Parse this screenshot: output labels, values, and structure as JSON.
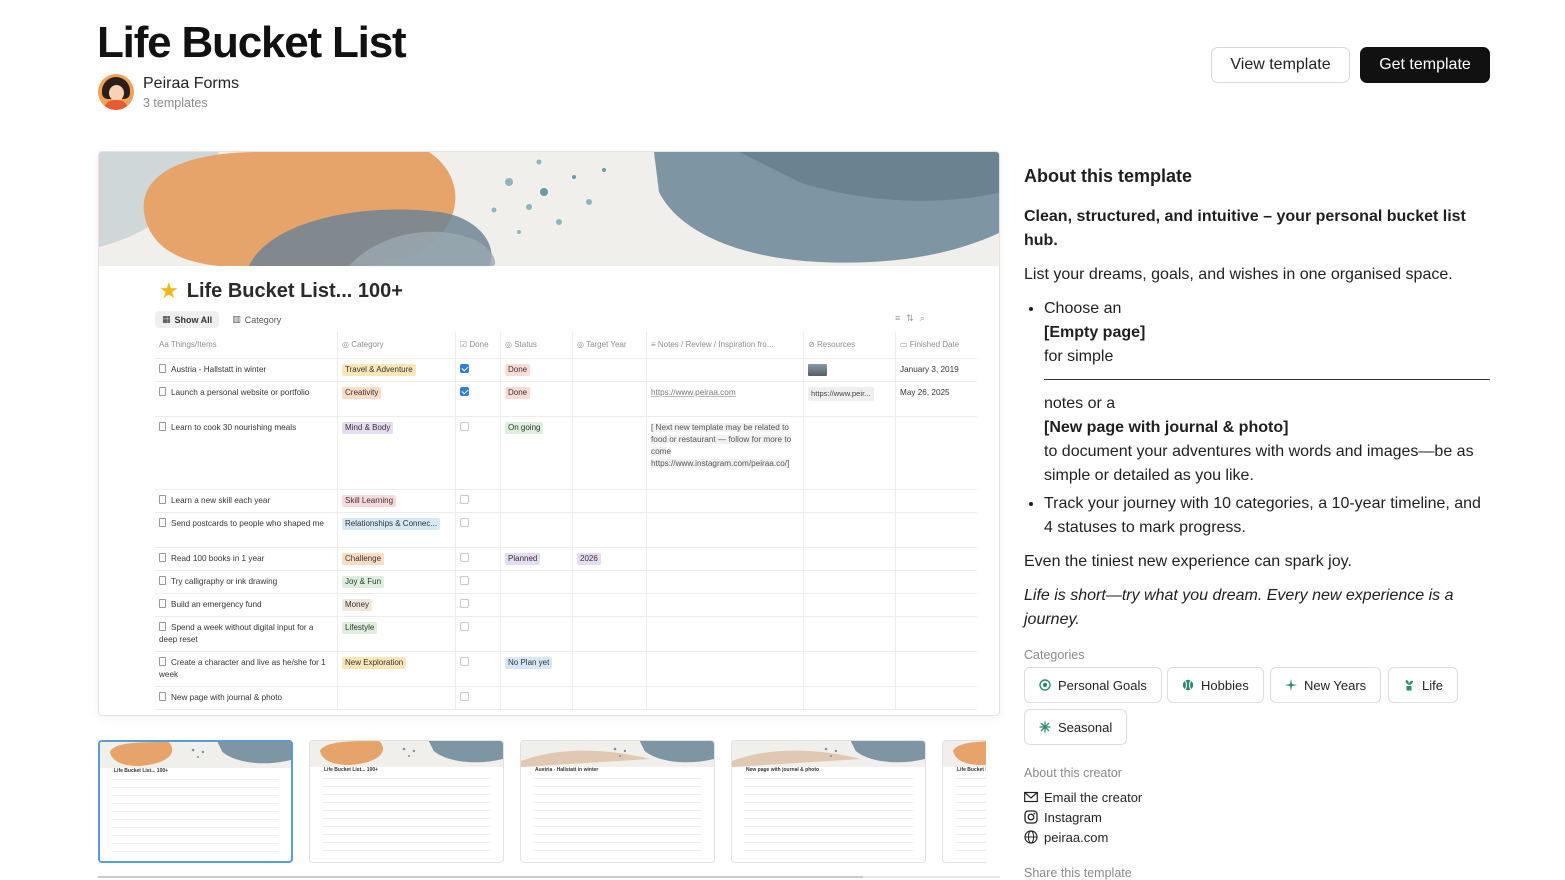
{
  "header": {
    "title": "Life Bucket List",
    "creator_name": "Peiraa Forms",
    "creator_sub": "3 templates",
    "view_label": "View template",
    "get_label": "Get template"
  },
  "preview": {
    "title": "Life Bucket List... 100+",
    "tabs": [
      "Show All",
      "Category"
    ],
    "columns": [
      "Things/Items",
      "Category",
      "Done",
      "Status",
      "Target Year",
      "Notes / Review / Inspiration fro...",
      "Resources",
      "Finished Date"
    ],
    "rows": [
      {
        "item": "Austria - Hallstatt in winter",
        "category": "Travel & Adventure",
        "done": true,
        "status": "Done",
        "year": "",
        "notes": "",
        "resources": "img",
        "finished": "January 3, 2019"
      },
      {
        "item": "Launch a personal website or portfolio",
        "category": "Creativity",
        "done": true,
        "status": "Done",
        "year": "",
        "notes": "https://www.peiraa.com",
        "resources": "https://www.peir...",
        "finished": "May 26, 2025"
      },
      {
        "item": "Learn to cook 30 nourishing meals",
        "category": "Mind & Body",
        "done": false,
        "status": "On going",
        "year": "",
        "notes": "[ Next new template may be related to food or restaurant — follow for more to come https://www.instagram.com/peiraa.co/]",
        "resources": "",
        "finished": ""
      },
      {
        "item": "Learn a new skill each year",
        "category": "Skill Learning",
        "done": false,
        "status": "",
        "year": "",
        "notes": "",
        "resources": "",
        "finished": ""
      },
      {
        "item": "Send postcards to people who shaped me",
        "category": "Relationships & Connec...",
        "done": false,
        "status": "",
        "year": "",
        "notes": "",
        "resources": "",
        "finished": ""
      },
      {
        "item": "Read 100 books in 1 year",
        "category": "Challenge",
        "done": false,
        "status": "Planned",
        "year": "2026",
        "notes": "",
        "resources": "",
        "finished": ""
      },
      {
        "item": "Try calligraphy or ink drawing",
        "category": "Joy & Fun",
        "done": false,
        "status": "",
        "year": "",
        "notes": "",
        "resources": "",
        "finished": ""
      },
      {
        "item": "Build an emergency fund",
        "category": "Money",
        "done": false,
        "status": "",
        "year": "",
        "notes": "",
        "resources": "",
        "finished": ""
      },
      {
        "item": "Spend a week without digital input for a deep reset",
        "category": "Lifestyle",
        "done": false,
        "status": "",
        "year": "",
        "notes": "",
        "resources": "",
        "finished": ""
      },
      {
        "item": "Create a character and live as he/she for 1 week",
        "category": "New Exploration",
        "done": false,
        "status": "No Plan yet",
        "year": "",
        "notes": "",
        "resources": "",
        "finished": ""
      },
      {
        "item": "New page with journal & photo",
        "category": "",
        "done": false,
        "status": "",
        "year": "",
        "notes": "",
        "resources": "",
        "finished": ""
      }
    ],
    "category_colors": {
      "Travel & Adventure": "#fbe6b8",
      "Creativity": "#fbdcc4",
      "Mind & Body": "#e6dcf2",
      "Skill Learning": "#f9d9dc",
      "Relationships & Connec...": "#d6e8f5",
      "Challenge": "#fbdcc4",
      "Joy & Fun": "#dcefdc",
      "Money": "#efe6dc",
      "Lifestyle": "#dcefdc",
      "New Exploration": "#fbe6b8"
    },
    "status_colors": {
      "Done": "#fbdcd4",
      "On going": "#dcefdc",
      "Planned": "#e6dcf2",
      "No Plan yet": "#d6e8f5"
    },
    "thumb_titles": [
      "Life Bucket List... 100+",
      "Life Bucket List... 100+",
      "Austria - Hallstatt in winter",
      "New page with journal & photo",
      "Life Bucket List..."
    ]
  },
  "about": {
    "heading": "About this template",
    "lead": "Clean, structured, and intuitive – your personal bucket list hub.",
    "intro": "List your dreams, goals, and wishes in one organised space.",
    "bullet1_a": "Choose an",
    "bullet1_b": "[Empty page]",
    "bullet1_c": "for simple",
    "bullet1_d": "notes or a",
    "bullet1_e": "[New page with journal & photo]",
    "bullet1_f": "to document your adventures with words and images—be as simple or detailed as you like.",
    "bullet2": "Track your journey with 10 categories, a 10-year timeline, and 4 statuses to mark progress.",
    "joy": "Even the tiniest new experience can spark joy.",
    "quote": "Life is short—try what you dream. Every new experience is a journey."
  },
  "categories": {
    "label": "Categories",
    "items": [
      {
        "label": "Personal Goals",
        "icon": "target-icon",
        "color": "#2e8b6e"
      },
      {
        "label": "Hobbies",
        "icon": "ball-icon",
        "color": "#2e8b6e"
      },
      {
        "label": "New Years",
        "icon": "sparkle-icon",
        "color": "#2e8b6e"
      },
      {
        "label": "Life",
        "icon": "plant-icon",
        "color": "#2e8b6e"
      },
      {
        "label": "Seasonal",
        "icon": "snowflake-icon",
        "color": "#2e8b6e"
      }
    ]
  },
  "creator_links": {
    "label": "About this creator",
    "email": "Email the creator",
    "instagram": "Instagram",
    "website": "peiraa.com"
  },
  "share": {
    "label": "Share this template"
  }
}
